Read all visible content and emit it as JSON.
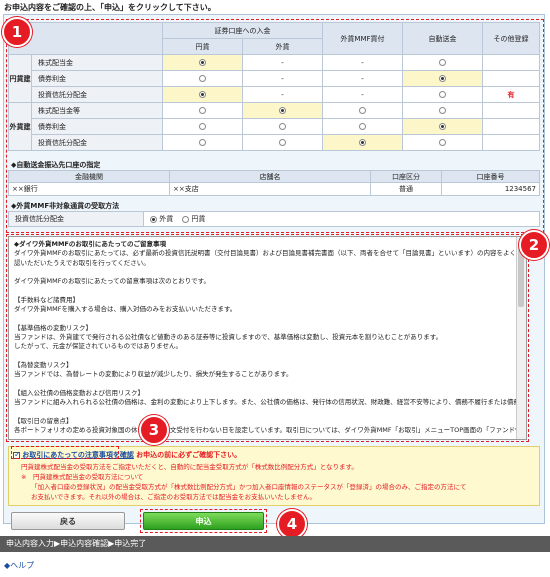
{
  "instruction": "お申込内容をご確認の上、「申込」をクリックして下さい。",
  "badges": [
    "1",
    "2",
    "3",
    "4"
  ],
  "table": {
    "group_header": "証券口座への入金",
    "col_jpy": "円貨",
    "col_fx": "外貨",
    "col_mmf": "外貨MMF買付",
    "col_auto": "自動送金",
    "col_other": "その他登録",
    "yen_group": "円貨建",
    "fx_group": "外貨建",
    "rows": [
      {
        "label": "株式配当金",
        "jpy": "on",
        "fx": "-",
        "mmf": "-",
        "auto": "off",
        "other": ""
      },
      {
        "label": "債券利金",
        "jpy": "off",
        "fx": "-",
        "mmf": "-",
        "auto": "on",
        "other": ""
      },
      {
        "label": "投資信託分配金",
        "jpy": "on",
        "fx": "-",
        "mmf": "-",
        "auto": "off",
        "other": "有"
      },
      {
        "label": "株式配当金等",
        "jpy": "off",
        "fx": "on",
        "mmf": "off",
        "auto": "off",
        "other": ""
      },
      {
        "label": "債券利金",
        "jpy": "off",
        "fx": "off",
        "mmf": "off",
        "auto": "on",
        "other": ""
      },
      {
        "label": "投資信託分配金",
        "jpy": "off",
        "fx": "off",
        "mmf": "on",
        "auto": "off",
        "other": ""
      }
    ]
  },
  "bank": {
    "title": "◆自動送金振込先口座の指定",
    "h_bank": "金融機関",
    "h_branch": "店舗名",
    "h_type": "口座区分",
    "h_no": "口座番号",
    "bank": "××銀行",
    "branch": "××支店",
    "type": "普通",
    "no": "1234567"
  },
  "mmf_method": {
    "title": "◆外貨MMF非対象通貨の受取方法",
    "label": "投資信託分配金",
    "opt1": "外貨",
    "opt2": "円貨"
  },
  "notes": [
    "◆ダイワ外貨MMFのお取引にあたってのご留意事項",
    "ダイワ外貨MMFのお取引にあたっては、必ず最新の投資信託説明書（交付目論見書）および目論見書補完書面（以下、両者を合せて「目論見書」といいます）の内容をよくお読みになり、お取引される投資信託の内容について十分ご理解いただいた上で、ご自身のご判断と責任でお取引いただきますようお願い申し上げます。",
    "認いただいたうえでお取引を行ってください。",
    "",
    "ダイワ外貨MMFのお取引にあたっての留意事項は次のとおりです。",
    "",
    "【手数料など諸費用】",
    "ダイワ外貨MMFを購入する場合は、購入対価のみをお支払いいただきます。",
    "",
    "【基準価格の変動リスク】",
    "当ファンドは、外貨建てで発行される公社債など値動きのある証券等に投資しますので、基準価格は変動し、投資元本を割り込むことがあります。",
    "したがって、元金が保証されているものではありません。",
    "",
    "【為替変動リスク】",
    "当ファンドでは、為替レートの変動により収益が減少したり、損失が発生することがあります。",
    "",
    "【組入公社債の価格変動および信用リスク】",
    "当ファンドに組み入れられる公社債の価格は、金利の変動により上下します。また、公社債の価格は、発行体の信用状況、財政難、経営不安等により、債務不履行または債務不履行になると予想される場合は大きく下落します。",
    "",
    "【取引日の留意点】",
    "各ポートフォリオの定める投資対象国の休日により注文受付を行わない日を設定しています。取引日については、ダイワ外貨MMF「お取引」メニューTOP画面の「ファンド情報」からご確認ください。"
  ],
  "agree": {
    "check_label": "お取引にあたっての注意事項を確認",
    "warn": "お申込の前に必ずご確認下さい。",
    "line1": "円貨建株式配当金の受取方法をご指定いただくと、自動的に配当金受取方式が「株式数比例配分方式」となります。",
    "line2": "※　円貨建株式配当金の受取方法について",
    "line3": "「加入者口座の登録状況」の配当金受取方式が「株式数比例配分方式」かつ加入者口座情報のステータスが「登録済」の場合のみ、ご指定の方法にて",
    "line4": "お支払いできます。それ以外の場合は、ご指定のお受取方法では配当金をお支払いいたしません。"
  },
  "buttons": {
    "back": "戻る",
    "apply": "申込"
  },
  "steps": "申込内容入力▶申込内容確認▶申込完了",
  "help": "◆ヘルプ"
}
